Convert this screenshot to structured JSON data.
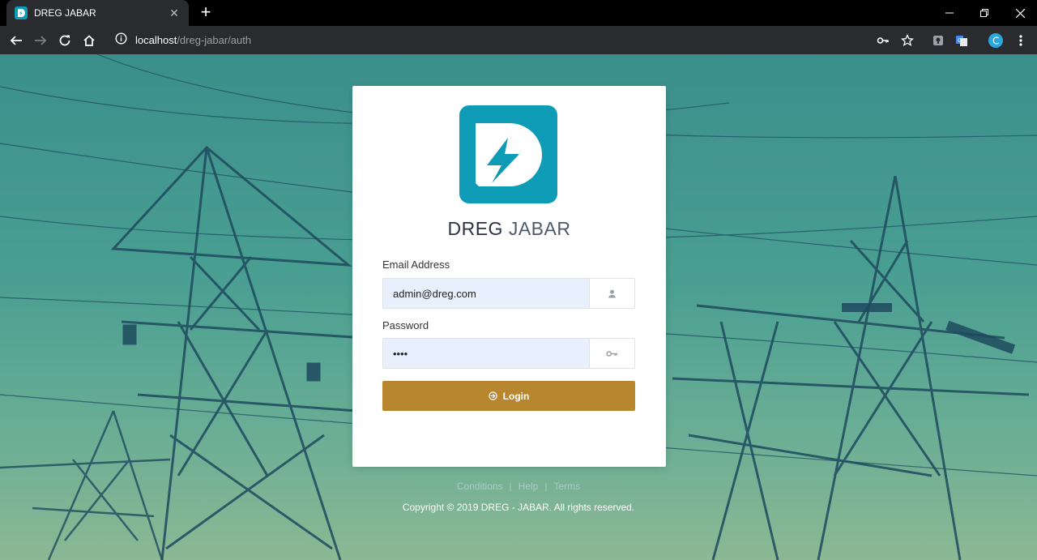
{
  "browser": {
    "tab_title": "DREG JABAR",
    "url_host": "localhost",
    "url_path": "/dreg-jabar/auth"
  },
  "brand": {
    "name_part1": "DREG",
    "name_part2": "JABAR",
    "logo_color": "#0d9bb5"
  },
  "form": {
    "email_label": "Email Address",
    "email_value": "admin@dreg.com",
    "password_label": "Password",
    "password_value": "••••",
    "login_label": "Login",
    "login_color": "#b8862f"
  },
  "footer": {
    "links": [
      "Conditions",
      "Help",
      "Terms"
    ],
    "copyright": "Copyright © 2019 DREG - JABAR. All rights reserved."
  }
}
